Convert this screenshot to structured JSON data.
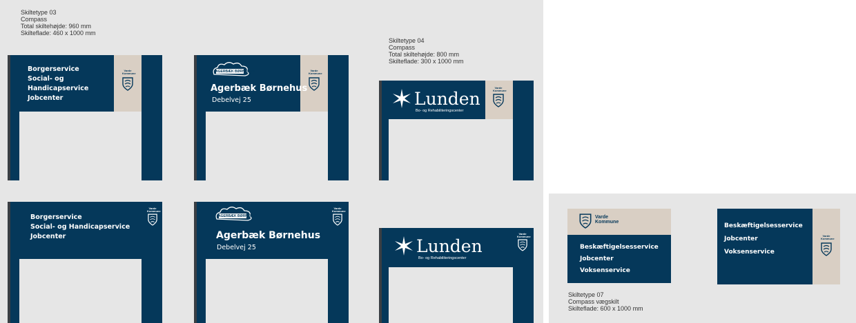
{
  "spec_03": [
    "Skiltetype 03",
    "Compass",
    "Total skiltehøjde: 960 mm",
    "Skilteflade: 460 x 1000 mm"
  ],
  "spec_04": [
    "Skiltetype 04",
    "Compass",
    "Total skiltehøjde: 800 mm",
    "Skilteflade: 300 x 1000 mm"
  ],
  "spec_07": [
    "Skiltetype 07",
    "Compass vægskilt",
    "Skilteflade: 600  x 1000 mm"
  ],
  "services_a": [
    "Borgerservice",
    "Social- og",
    "Handicapservice",
    "Jobcenter"
  ],
  "services_b": [
    "Borgerservice",
    "Social- og Handicapservice",
    "Jobcenter"
  ],
  "agerbaek": {
    "title": "Agerbæk Børnehus",
    "address": "Debelvej 25",
    "logo_text": "AGERBÆK BØRNEHUS"
  },
  "lunden": {
    "name": "Lunden",
    "subtitle": "Bo- og Rehabiliteringscenter"
  },
  "kommune_small": [
    "Varde",
    "Kommune"
  ],
  "kommune_logo": [
    "Varde",
    "Kommune"
  ],
  "wall_services": [
    "Beskæftigelsesservice",
    "Jobcenter",
    "Voksenservice"
  ],
  "colors": {
    "navy": "#05385a",
    "beige": "#d9cfc4",
    "background": "#e6e6e6"
  },
  "icons": [
    "varde-shield-icon",
    "lunden-star-icon",
    "agerbaek-logo-icon"
  ]
}
